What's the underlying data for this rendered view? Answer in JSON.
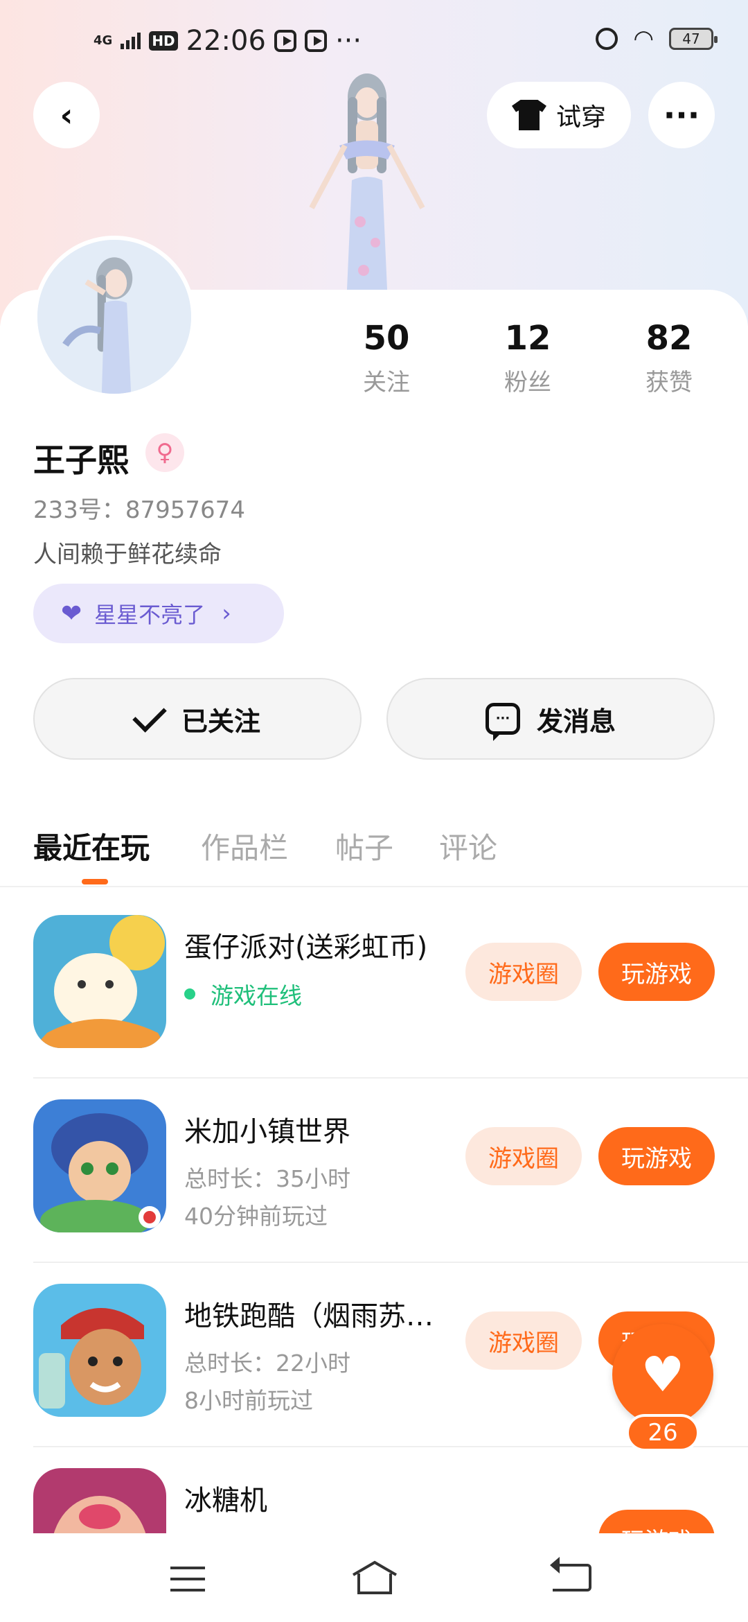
{
  "status_bar": {
    "network": "4G",
    "hd": "HD",
    "time": "22:06",
    "more": "···",
    "battery": "47"
  },
  "header": {
    "try_on_label": "试穿",
    "more_icon": "···"
  },
  "profile": {
    "stats": [
      {
        "value": "50",
        "label": "关注"
      },
      {
        "value": "12",
        "label": "粉丝"
      },
      {
        "value": "82",
        "label": "获赞"
      }
    ],
    "name": "王子熙",
    "gender_symbol": "♀",
    "user_id": "233号：87957674",
    "bio": "人间赖于鲜花续命",
    "star_chip": "星星不亮了",
    "follow_button": "已关注",
    "message_button": "发消息"
  },
  "tabs": [
    {
      "label": "最近在玩"
    },
    {
      "label": "作品栏"
    },
    {
      "label": "帖子"
    },
    {
      "label": "评论"
    }
  ],
  "games": [
    {
      "title": "蛋仔派对(送彩虹币)",
      "status": "游戏在线",
      "circle_btn": "游戏圈",
      "play_btn": "玩游戏"
    },
    {
      "title": "米加小镇世界",
      "duration": "总时长：35小时",
      "last_played": "40分钟前玩过",
      "circle_btn": "游戏圈",
      "play_btn": "玩游戏"
    },
    {
      "title": "地铁跑酷（烟雨苏…",
      "duration": "总时长：22小时",
      "last_played": "8小时前玩过",
      "circle_btn": "游戏圈",
      "play_btn": "玩游戏"
    },
    {
      "title": "冰糖机",
      "play_btn": "玩游戏"
    }
  ],
  "fab": {
    "count": "26"
  },
  "accent_color": "#ff6a1a"
}
